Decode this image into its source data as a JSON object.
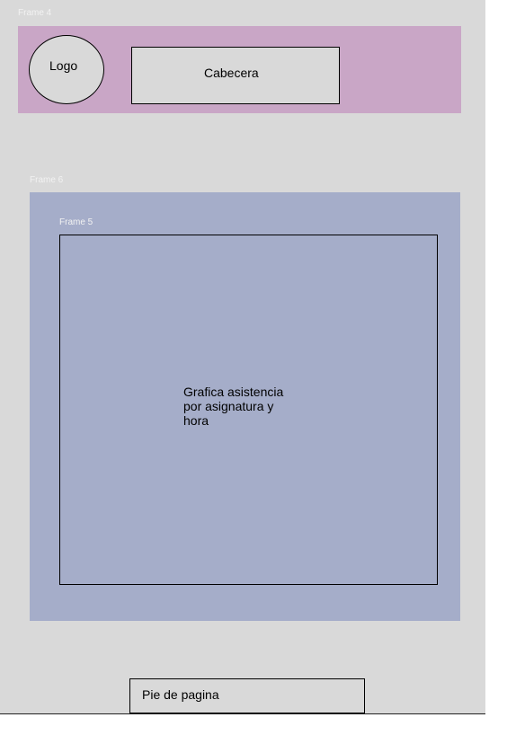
{
  "frames": {
    "frame4_label": "Frame 4",
    "frame6_label": "Frame 6",
    "frame5_label": "Frame 5"
  },
  "header": {
    "logo_label": "Logo",
    "title_label": "Cabecera"
  },
  "main": {
    "chart_placeholder_line1": "Grafica asistencia",
    "chart_placeholder_line2": "por asignatura y",
    "chart_placeholder_line3": "hora"
  },
  "footer": {
    "label": "Pie de pagina"
  },
  "colors": {
    "canvas": "#d9d9d9",
    "header_band": "#c9a6c6",
    "content_frame": "#a5adc9"
  }
}
